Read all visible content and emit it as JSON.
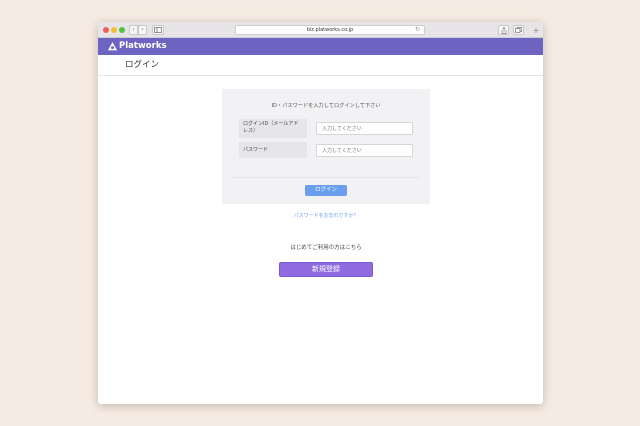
{
  "browser": {
    "url": "biz.platworks.co.jp",
    "back_glyph": "‹",
    "forward_glyph": "›",
    "reload_glyph": "↻",
    "new_tab_glyph": "+"
  },
  "app": {
    "brand": "Platworks",
    "bar_color": "#6d64c1"
  },
  "page": {
    "title": "ログイン"
  },
  "login_form": {
    "instruction": "ID・パスワードを入力してログインして下さい",
    "email_label": "ログインID（メールアドレス）",
    "email_placeholder": "入力してください",
    "password_label": "パスワード",
    "password_placeholder": "入力してください",
    "submit_label": "ログイン",
    "submit_color": "#6a9fee"
  },
  "links": {
    "forgot_password": "パスワードをお忘れですか？"
  },
  "signup": {
    "prompt": "はじめてご利用の方はこちら",
    "button_label": "新規登録",
    "button_color": "#8f6de1"
  },
  "icons": {
    "logo": "cloud-triangle-logo-icon",
    "sidebar": "sidebar-icon",
    "share": "share-icon",
    "tabs": "tabs-icon"
  }
}
